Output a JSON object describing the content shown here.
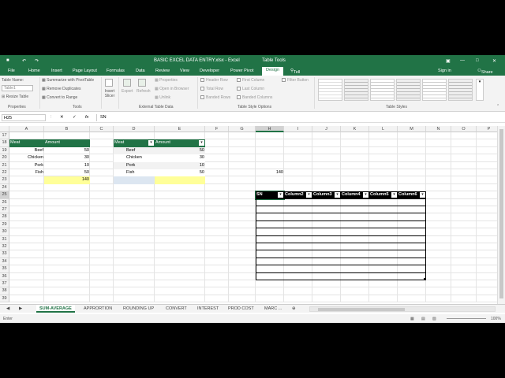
{
  "window": {
    "title": "BASIC EXCEL DATA ENTRY.xlsx - Excel",
    "context_tab": "Table Tools",
    "sign_in": "Sign in",
    "share": "Share"
  },
  "ribbon_tabs": [
    "File",
    "Home",
    "Insert",
    "Page Layout",
    "Formulas",
    "Data",
    "Review",
    "View",
    "Developer",
    "Power Pivot",
    "Design"
  ],
  "tell_me": "Tell me what you want to do...",
  "ribbon": {
    "table_name_label": "Table Name:",
    "table_name_value": "Table1",
    "resize_table": "Resize Table",
    "properties_group": "Properties",
    "summarize": "Summarize with PivotTable",
    "remove_duplicates": "Remove Duplicates",
    "convert_to_range": "Convert to Range",
    "tools_group": "Tools",
    "insert_slicer": "Insert Slicer",
    "export": "Export",
    "refresh": "Refresh",
    "properties": "Properties",
    "open_in_browser": "Open in Browser",
    "unlink": "Unlink",
    "external_group": "External Table Data",
    "header_row": "Header Row",
    "total_row": "Total Row",
    "banded_rows": "Banded Rows",
    "first_column": "First Column",
    "last_column": "Last Column",
    "banded_columns": "Banded Columns",
    "filter_button": "Filter Button",
    "style_options_group": "Table Style Options",
    "table_styles_group": "Table Styles"
  },
  "formula_bar": {
    "name_box": "H25",
    "fx": "fx",
    "content": "SN"
  },
  "columns": [
    "A",
    "B",
    "C",
    "D",
    "E",
    "F",
    "G",
    "H",
    "I",
    "J",
    "K",
    "L",
    "M",
    "N",
    "O",
    "P"
  ],
  "rows": [
    "17",
    "18",
    "19",
    "20",
    "21",
    "22",
    "23",
    "24",
    "25",
    "26",
    "27",
    "28",
    "29",
    "30",
    "31",
    "32",
    "33",
    "34",
    "35",
    "36",
    "37",
    "38",
    "39"
  ],
  "table1": {
    "header_meat": "Meat",
    "header_amount": "Amount",
    "items": [
      [
        "Beef",
        "50"
      ],
      [
        "Chicken",
        "30"
      ],
      [
        "Pork",
        "10"
      ],
      [
        "Fish",
        "50"
      ]
    ],
    "total": "140"
  },
  "table2": {
    "header_meat": "Meat",
    "header_amount": "Amount",
    "items": [
      [
        "Beef",
        "50"
      ],
      [
        "Chicken",
        "30"
      ],
      [
        "Pork",
        "10"
      ],
      [
        "Fish",
        "50"
      ]
    ]
  },
  "h22_value": "140",
  "table3": {
    "headers": [
      "SN",
      "Column2",
      "Column3",
      "Column4",
      "Column5",
      "Column6"
    ]
  },
  "sheet_tabs": [
    "SUM-AVERAGE",
    "APPRORTION",
    "ROUNDING UP",
    "CONVERT",
    "INTEREST",
    "PROD COST",
    "MARC ..."
  ],
  "active_sheet": "SUM-AVERAGE",
  "status": {
    "mode": "Enter",
    "zoom": "100%"
  },
  "colors": {
    "excel_green": "#217346",
    "table_header": "#217346",
    "highlight_yellow": "#ffff99"
  }
}
